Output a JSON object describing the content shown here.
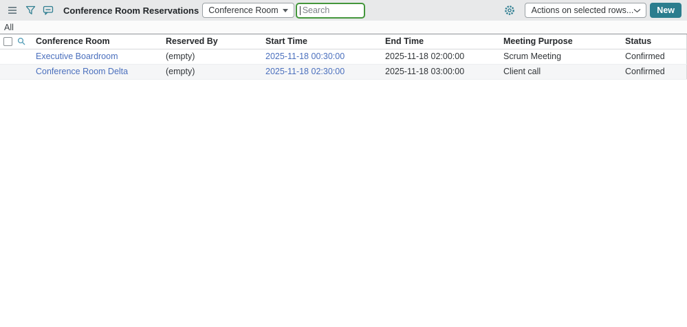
{
  "topbar": {
    "title": "Conference Room Reservations",
    "table_selector_label": "Conference Room",
    "search_placeholder": "Search",
    "search_value": "",
    "actions_value": "Actions on selected rows...",
    "new_label": "New",
    "icons": [
      "list-menu-icon",
      "filter-icon",
      "chat-icon",
      "gear-icon",
      "chevron-down-icon"
    ]
  },
  "breadcrumb": {
    "all_label": "All"
  },
  "table": {
    "columns": [
      "Conference Room",
      "Reserved By",
      "Start Time",
      "End Time",
      "Meeting Purpose",
      "Status"
    ],
    "rows": [
      {
        "conference_room": "Executive Boardroom",
        "reserved_by": "(empty)",
        "start_time": "2025-11-18 00:30:00",
        "end_time": "2025-11-18 02:00:00",
        "meeting_purpose": "Scrum Meeting",
        "status": "Confirmed"
      },
      {
        "conference_room": "Conference Room Delta",
        "reserved_by": "(empty)",
        "start_time": "2025-11-18 02:30:00",
        "end_time": "2025-11-18 03:00:00",
        "meeting_purpose": "Client call",
        "status": "Confirmed"
      }
    ]
  },
  "colors": {
    "accent_teal": "#2b7d8e",
    "link_blue": "#4a6fbd",
    "search_focus_green": "#43963b",
    "topbar_bg": "#e8e9ea",
    "zebra_row_bg": "#f5f6f7"
  }
}
